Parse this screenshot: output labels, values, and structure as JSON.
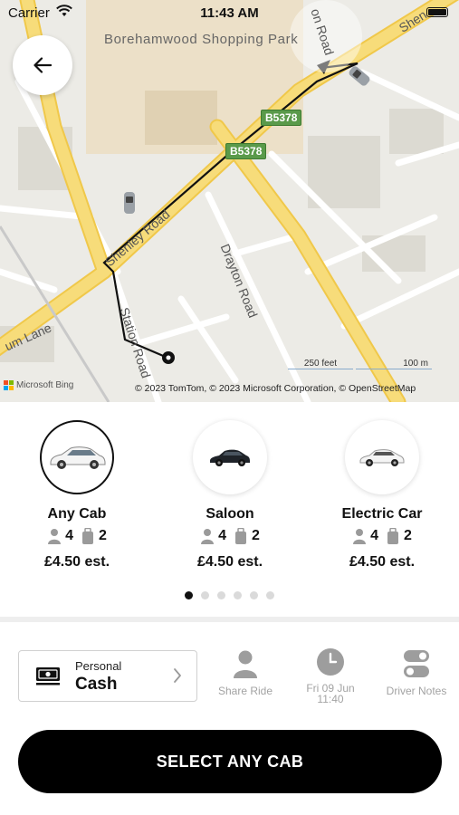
{
  "status_bar": {
    "carrier": "Carrier",
    "time": "11:43 AM"
  },
  "map": {
    "poi_label": "Borehamwood Shopping Park",
    "road_shields": [
      "B5378",
      "B5378"
    ],
    "road_labels": {
      "shenley_road": "Shenley Road",
      "drayton_road": "Drayton Road",
      "station_road": "Station Road",
      "elstree_lane": "um Lane",
      "top_road": "on Road",
      "top_right": "Shen"
    },
    "scale": {
      "feet": "250 feet",
      "meters": "100 m"
    },
    "attribution": "© 2023 TomTom, © 2023 Microsoft Corporation, © OpenStreetMap",
    "provider_logo_text": "Microsoft Bing",
    "colors": {
      "land": "#ecebe6",
      "major_road": "#f5d469",
      "minor_road": "#ffffff",
      "route": "#111111",
      "shield": "#5a9a4a"
    }
  },
  "vehicles": [
    {
      "name": "Any Cab",
      "passengers": "4",
      "bags": "2",
      "price": "£4.50 est.",
      "selected": true,
      "icon": "white-prius-icon"
    },
    {
      "name": "Saloon",
      "passengers": "4",
      "bags": "2",
      "price": "£4.50 est.",
      "selected": false,
      "icon": "black-saloon-icon"
    },
    {
      "name": "Electric Car",
      "passengers": "4",
      "bags": "2",
      "price": "£4.50 est.",
      "selected": false,
      "icon": "white-electric-car-icon"
    }
  ],
  "pagination": {
    "count": 6,
    "active": 0
  },
  "payment": {
    "subtitle": "Personal",
    "method": "Cash"
  },
  "options": {
    "share_ride": "Share Ride",
    "date_line1": "Fri 09 Jun",
    "date_line2": "11:40",
    "driver_notes": "Driver Notes"
  },
  "cta": {
    "label": "SELECT ANY CAB"
  }
}
